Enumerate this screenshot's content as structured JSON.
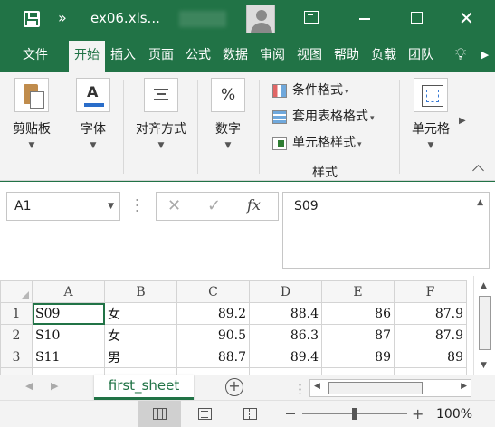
{
  "titlebar": {
    "title": "ex06.xls..."
  },
  "tabs": [
    {
      "label": "文件"
    },
    {
      "label": "开始"
    },
    {
      "label": "插入"
    },
    {
      "label": "页面"
    },
    {
      "label": "公式"
    },
    {
      "label": "数据"
    },
    {
      "label": "审阅"
    },
    {
      "label": "视图"
    },
    {
      "label": "帮助"
    },
    {
      "label": "负载"
    },
    {
      "label": "团队"
    }
  ],
  "ribbon": {
    "clipboard_label": "剪贴板",
    "font_label": "字体",
    "font_icon_text": "A",
    "alignment_label": "对齐方式",
    "number_label": "数字",
    "number_icon_text": "%",
    "styles": {
      "conditional_format": "条件格式",
      "format_as_table": "套用表格格式",
      "cell_styles": "单元格样式",
      "group_label": "样式"
    },
    "cells_label": "单元格"
  },
  "formula_bar": {
    "name_box": "A1",
    "fx_label": "fx",
    "content": "S09"
  },
  "sheet": {
    "columns": [
      "A",
      "B",
      "C",
      "D",
      "E",
      "F"
    ],
    "rows": [
      {
        "num": "1",
        "cells": [
          "S09",
          "女",
          "89.2",
          "88.4",
          "86",
          "87.9"
        ]
      },
      {
        "num": "2",
        "cells": [
          "S10",
          "女",
          "90.5",
          "86.3",
          "87",
          "87.9"
        ]
      },
      {
        "num": "3",
        "cells": [
          "S11",
          "男",
          "88.7",
          "89.4",
          "89",
          "89"
        ]
      }
    ]
  },
  "sheet_tabs": {
    "active": "first_sheet",
    "add_symbol": "⊕"
  },
  "status": {
    "zoom": "100%"
  },
  "colors": {
    "brand": "#217346"
  }
}
